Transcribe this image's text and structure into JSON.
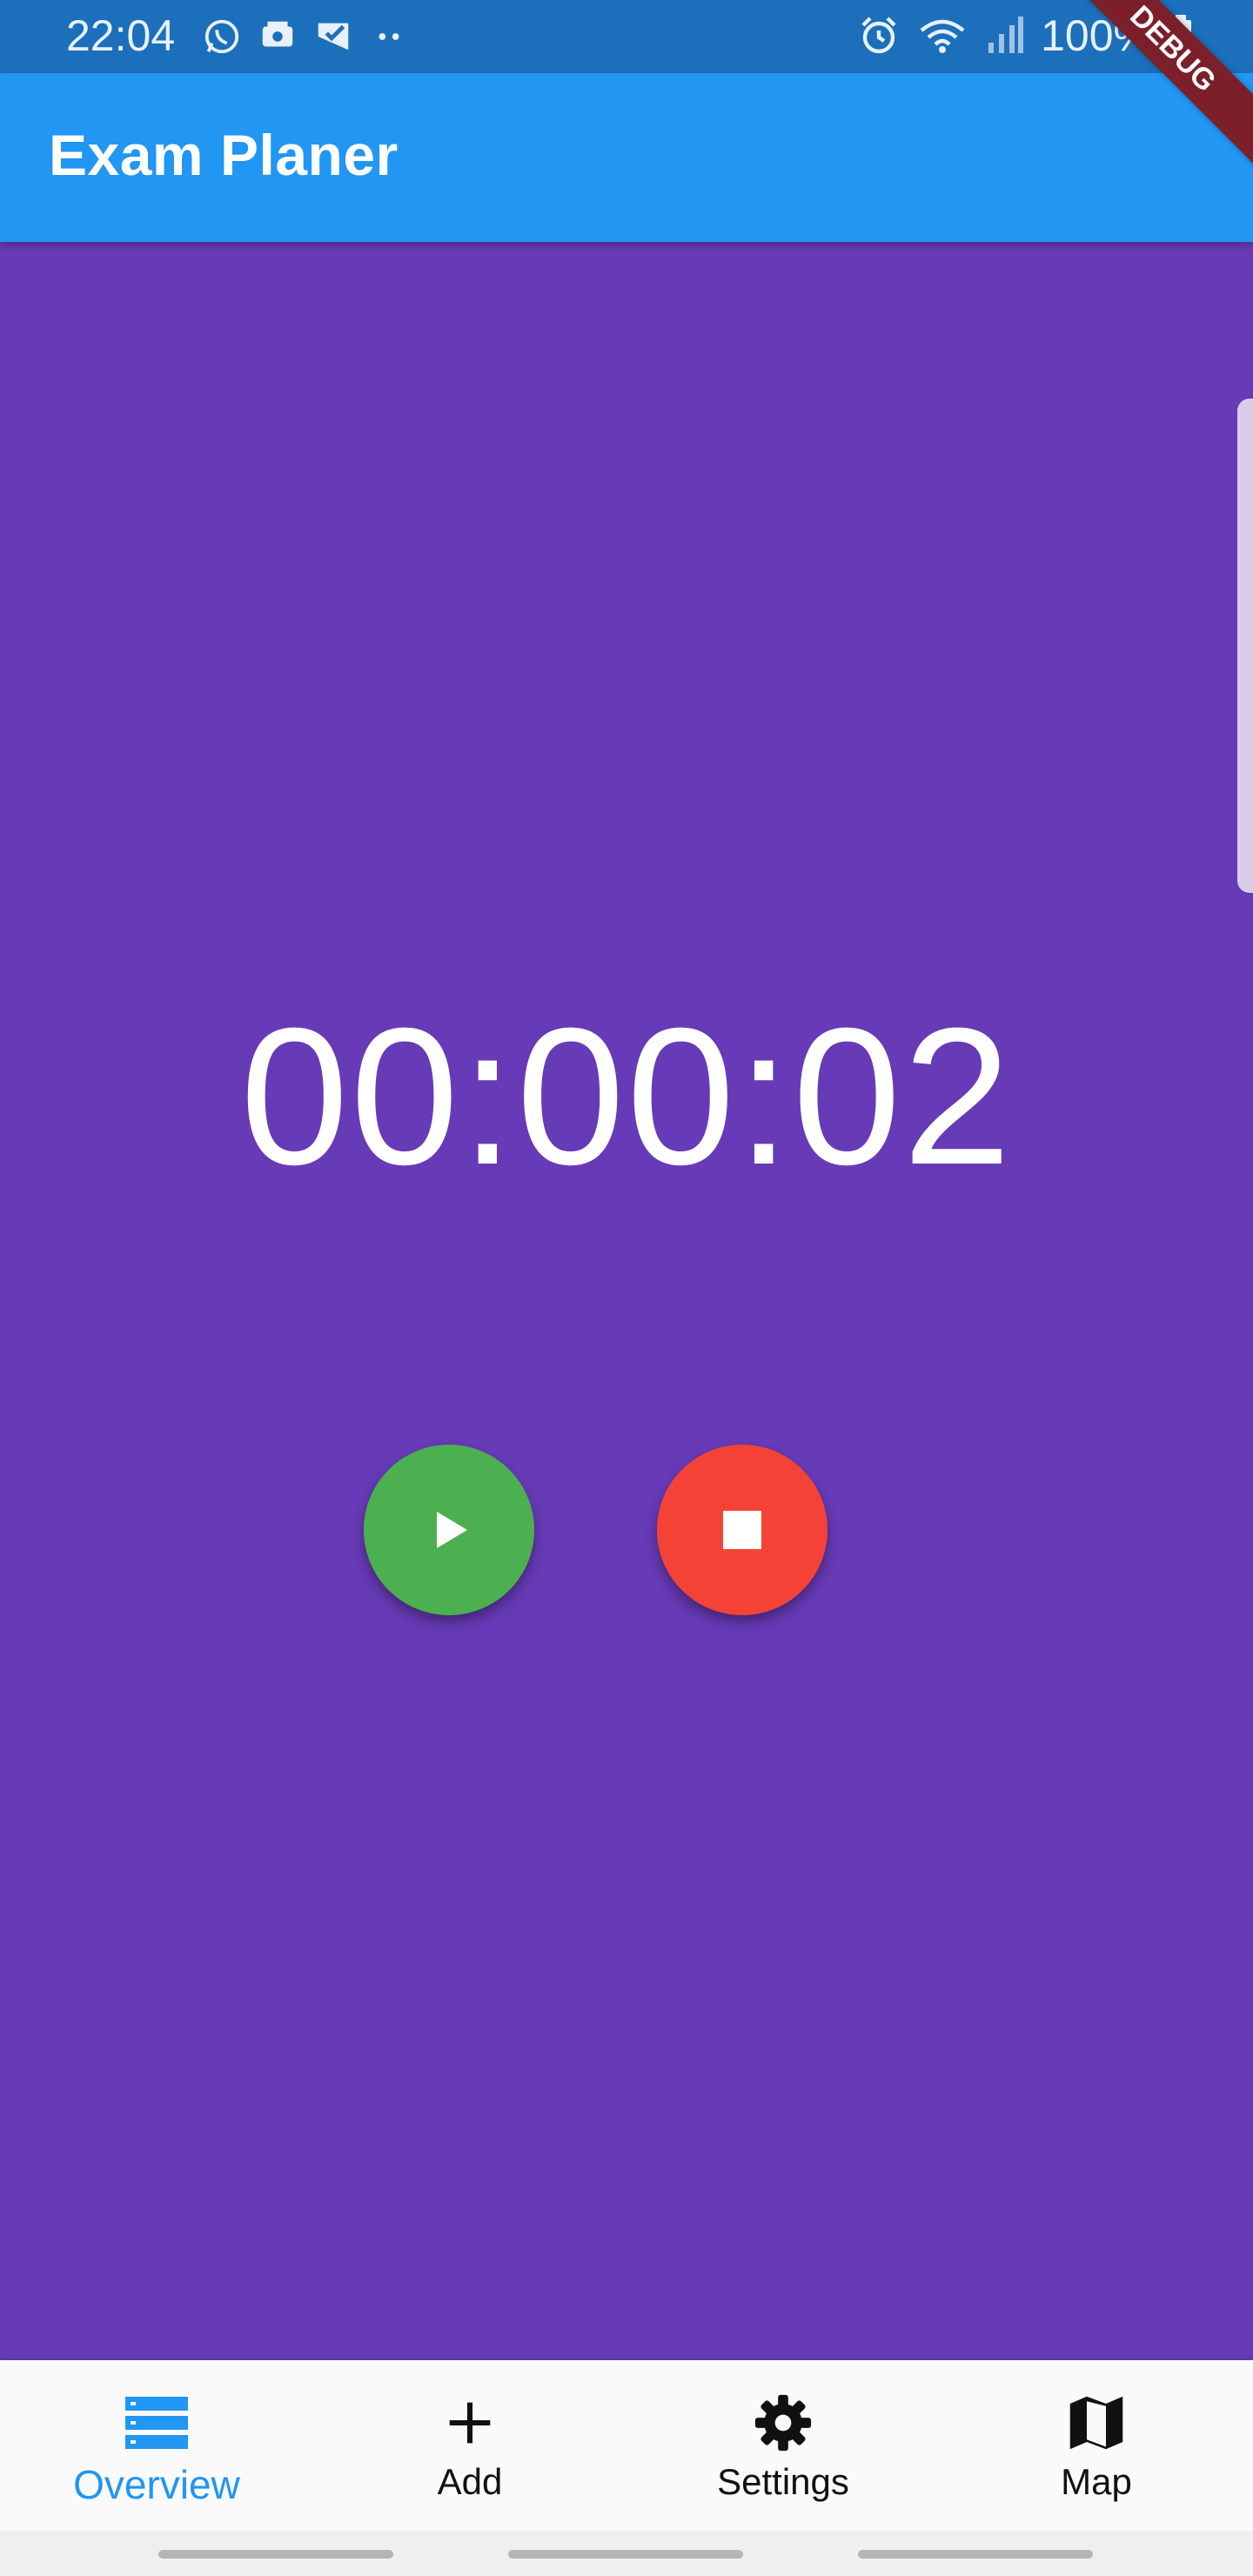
{
  "status_bar": {
    "time": "22:04",
    "battery": "100%",
    "icons": [
      "whatsapp-icon",
      "app-notification-icon",
      "check-notification-icon",
      "more-dots-icon",
      "alarm-icon",
      "wifi-icon",
      "signal-icon",
      "battery-icon"
    ]
  },
  "app_bar": {
    "title": "Exam Planer",
    "debug_banner": "DEBUG"
  },
  "main": {
    "timer": "00:00:02",
    "buttons": {
      "play": "play-icon",
      "stop": "stop-icon"
    }
  },
  "bottom_nav": {
    "items": [
      {
        "label": "Overview",
        "icon": "list-icon",
        "active": true
      },
      {
        "label": "Add",
        "icon": "plus-icon",
        "active": false
      },
      {
        "label": "Settings",
        "icon": "gear-icon",
        "active": false
      },
      {
        "label": "Map",
        "icon": "map-icon",
        "active": false
      }
    ]
  },
  "colors": {
    "background": "#673ab7",
    "app_bar": "#2196f3",
    "status_bar": "#1c6fba",
    "play": "#4caf50",
    "stop": "#f44336",
    "nav_active": "#2196f3"
  }
}
